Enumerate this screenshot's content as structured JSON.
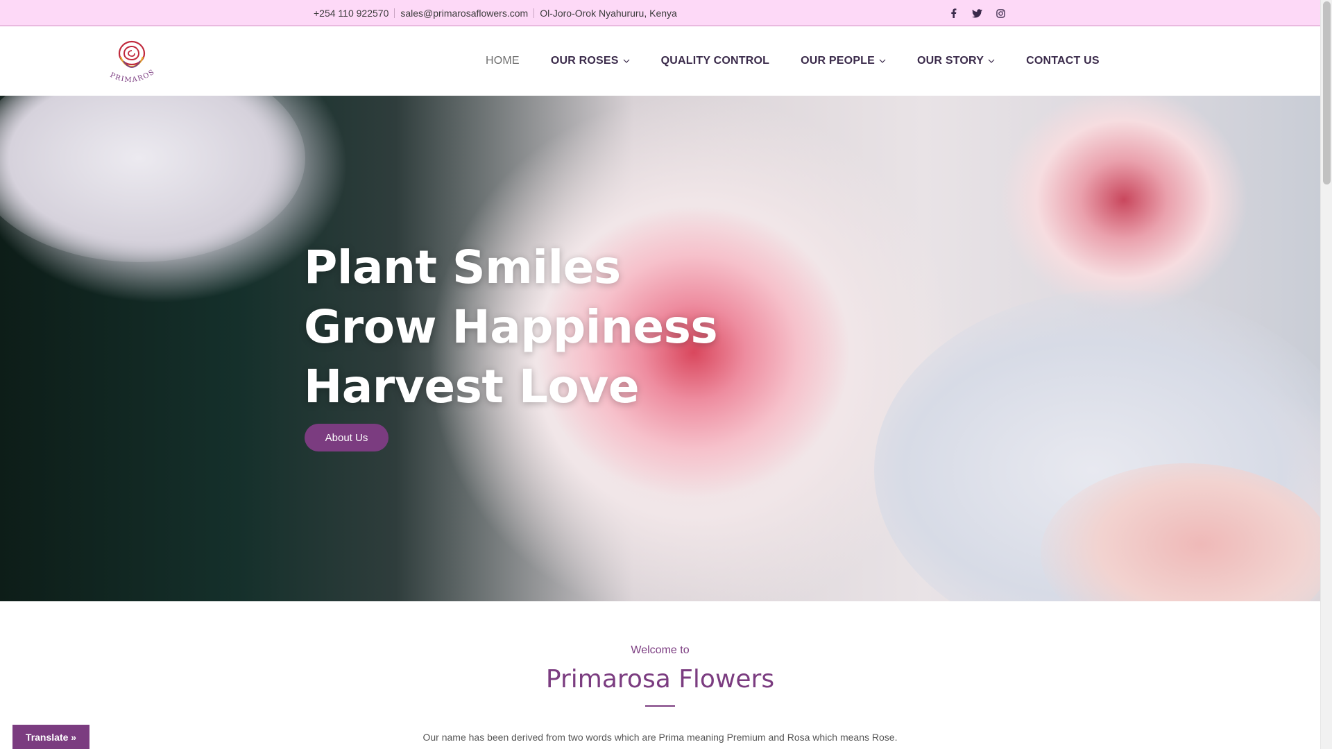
{
  "topbar": {
    "phone": "+254 110 922570",
    "email": "sales@primarosaflowers.com",
    "location": "Ol-Joro-Orok Nyahururu, Kenya",
    "social": [
      "facebook-icon",
      "twitter-icon",
      "instagram-icon"
    ]
  },
  "header": {
    "logo_text": "PRIMAROSA",
    "nav": [
      {
        "label": "HOME",
        "active": true,
        "dropdown": false
      },
      {
        "label": "OUR ROSES",
        "active": false,
        "dropdown": true
      },
      {
        "label": "QUALITY CONTROL",
        "active": false,
        "dropdown": false
      },
      {
        "label": "OUR PEOPLE",
        "active": false,
        "dropdown": true
      },
      {
        "label": "OUR STORY",
        "active": false,
        "dropdown": true
      },
      {
        "label": "CONTACT US",
        "active": false,
        "dropdown": false
      }
    ]
  },
  "hero": {
    "lines": [
      "Plant Smiles",
      "Grow Happiness",
      "Harvest Love"
    ],
    "button": "About Us"
  },
  "welcome": {
    "subtitle": "Welcome to",
    "title": "Primarosa Flowers",
    "text": "Our name has been derived from two words which are Prima meaning Premium and Rosa which means Rose."
  },
  "translate": {
    "label": "Translate »"
  },
  "colors": {
    "accent": "#7b3c80",
    "topbar": "#fdd9f7",
    "nav_text": "#3a2a4a"
  }
}
